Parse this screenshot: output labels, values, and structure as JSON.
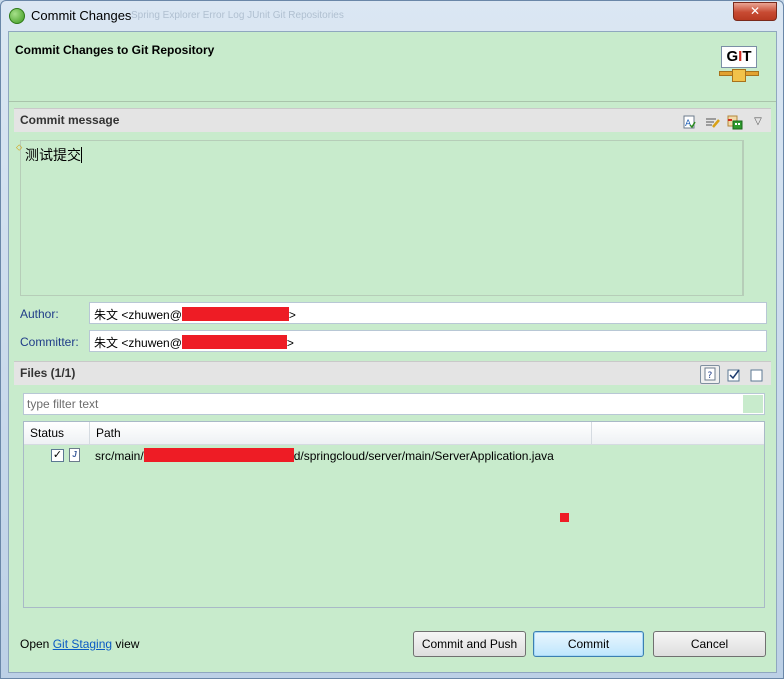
{
  "window": {
    "title": "Commit Changes",
    "close_label": "✕",
    "ghost_tabs": "Spring Explorer   Error Log   JUnit   Git Repositories"
  },
  "header": {
    "title": "Commit Changes to Git Repository",
    "logo_text_g": "G",
    "logo_text_i": "I",
    "logo_text_t": "T"
  },
  "commit_message": {
    "section_title": "Commit message",
    "text": "测试提交"
  },
  "author": {
    "label": "Author:",
    "prefix": "朱文 <zhuwen@",
    "suffix": ">"
  },
  "committer": {
    "label": "Committer:",
    "prefix": "朱文 <zhuwen@",
    "suffix": ">"
  },
  "files": {
    "section_title": "Files (1/1)",
    "filter_placeholder": "type filter text",
    "columns": [
      "Status",
      "Path"
    ],
    "rows": [
      {
        "checked": true,
        "path_prefix": "src/main/",
        "path_suffix": "d/springcloud/server/main/ServerApplication.java"
      }
    ]
  },
  "footer": {
    "open_text": "Open",
    "link_text": "Git Staging",
    "view_text": "view"
  },
  "buttons": {
    "commit_and_push": "Commit and Push",
    "commit": "Commit",
    "cancel": "Cancel"
  },
  "icons": {
    "toolbar_left": "spell-check-icon",
    "toolbar_mid": "sign-off-icon",
    "toolbar_right": "change-id-icon",
    "menu": "dropdown-menu-icon"
  },
  "colors": {
    "panel": "#c8ebcc",
    "link": "#0a5bc4",
    "redaction": "#ee1c25"
  }
}
